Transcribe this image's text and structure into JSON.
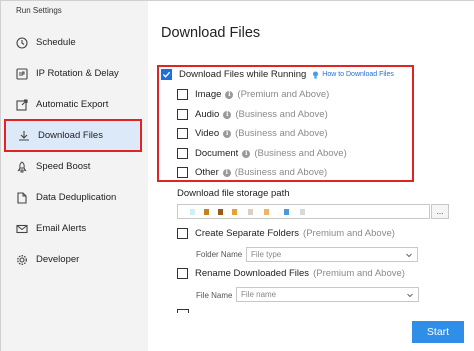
{
  "window": {
    "title": "Run Settings"
  },
  "sidebar": {
    "items": [
      {
        "label": "Schedule",
        "icon": "clock-icon"
      },
      {
        "label": "IP Rotation & Delay",
        "icon": "ip-icon"
      },
      {
        "label": "Automatic Export",
        "icon": "export-icon"
      },
      {
        "label": "Download Files",
        "icon": "download-icon",
        "active": true
      },
      {
        "label": "Speed Boost",
        "icon": "rocket-icon"
      },
      {
        "label": "Data Deduplication",
        "icon": "document-icon"
      },
      {
        "label": "Email Alerts",
        "icon": "email-icon"
      },
      {
        "label": "Developer",
        "icon": "gear-icon"
      }
    ]
  },
  "main": {
    "title": "Download Files",
    "download_while_running": {
      "label": "Download Files while Running",
      "checked": true,
      "help_link": "How to Download Files"
    },
    "file_types": [
      {
        "label": "Image",
        "note": "(Premium and Above)",
        "checked": false
      },
      {
        "label": "Audio",
        "note": "(Business and Above)",
        "checked": false
      },
      {
        "label": "Video",
        "note": "(Business and Above)",
        "checked": false
      },
      {
        "label": "Document",
        "note": "(Business and Above)",
        "checked": false
      },
      {
        "label": "Other",
        "note": "(Business and Above)",
        "checked": false
      }
    ],
    "storage_path": {
      "label": "Download file storage path",
      "browse_label": "..."
    },
    "separate_folders": {
      "label": "Create Separate Folders",
      "note": "(Premium and Above)",
      "checked": false,
      "sub_label": "Folder Name",
      "placeholder": "File type"
    },
    "rename_files": {
      "label": "Rename Downloaded Files",
      "note": "(Premium and Above)",
      "checked": false,
      "sub_label": "File Name",
      "placeholder": "File name"
    },
    "start_button": "Start"
  },
  "colors": {
    "accent": "#2f8fe8",
    "highlight_border": "#e02424",
    "active_bg": "#dbe9f8",
    "checkbox_checked": "#1e6fd9"
  }
}
